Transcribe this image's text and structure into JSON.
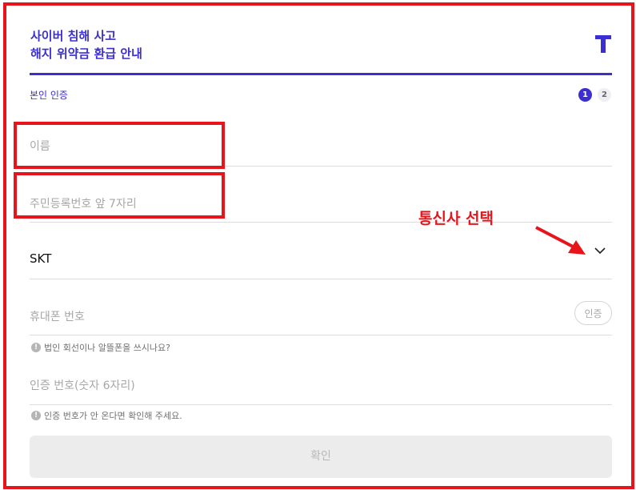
{
  "header": {
    "title_line1": "사이버 침해 사고",
    "title_line2": "해지 위약금 환급 안내"
  },
  "auth": {
    "label": "본인 인증",
    "steps": [
      "1",
      "2"
    ]
  },
  "form": {
    "name_placeholder": "이름",
    "rrn_placeholder": "주민등록번호 앞 7자리",
    "carrier_value": "SKT",
    "phone_placeholder": "휴대폰 번호",
    "verify_button": "인증",
    "phone_hint": "법인 회선이나 알뜰폰을 쓰시나요?",
    "code_placeholder": "인증 번호(숫자 6자리)",
    "code_hint": "인증 번호가 안 온다면 확인해 주세요.",
    "confirm_button": "확인"
  },
  "annotation": {
    "carrier_text": "통신사 선택"
  },
  "colors": {
    "accent": "#3b2fd0",
    "annotation_red": "#e8141b"
  }
}
